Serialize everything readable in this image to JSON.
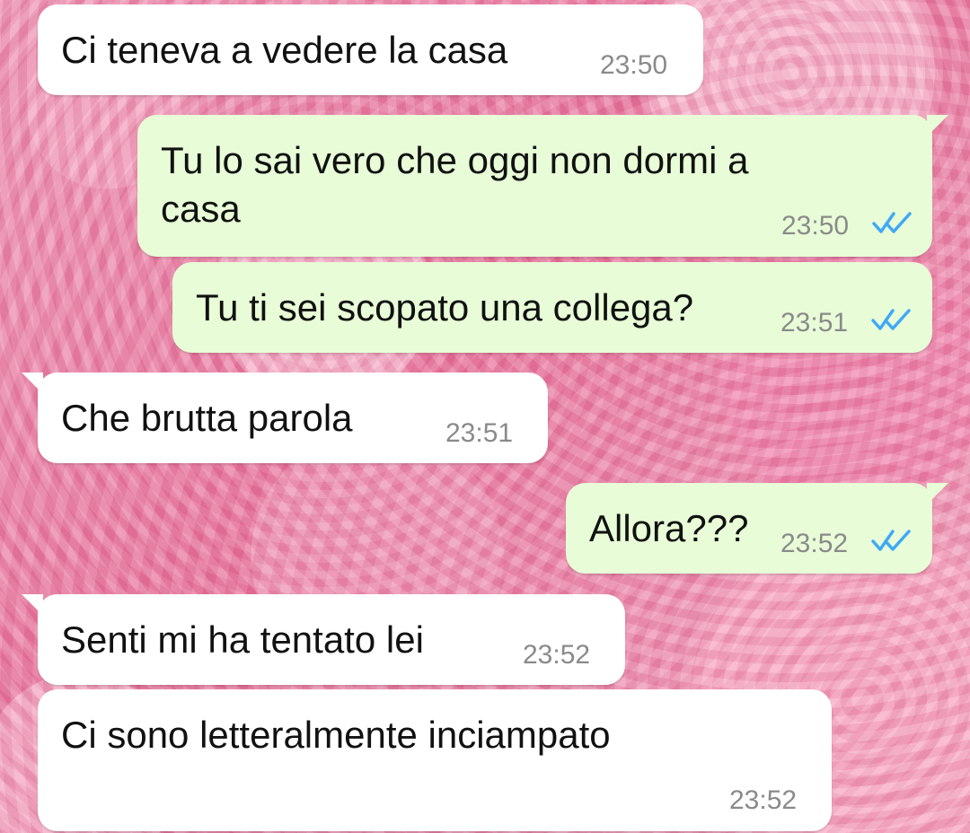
{
  "messages": [
    {
      "direction": "incoming",
      "text": "Ci teneva a vedere la casa",
      "time": "23:50"
    },
    {
      "direction": "outgoing",
      "text": "Tu lo sai vero che oggi non dormi a\ncasa",
      "time": "23:50",
      "status_icon": "double-check-icon"
    },
    {
      "direction": "outgoing",
      "text": "Tu ti sei scopato una collega?",
      "time": "23:51",
      "status_icon": "double-check-icon"
    },
    {
      "direction": "incoming",
      "text": "Che brutta parola",
      "time": "23:51"
    },
    {
      "direction": "outgoing",
      "text": "Allora???",
      "time": "23:52",
      "status_icon": "double-check-icon"
    },
    {
      "direction": "incoming",
      "text": "Senti mi ha tentato lei",
      "time": "23:52"
    },
    {
      "direction": "incoming",
      "text": "Ci sono letteralmente inciampato",
      "time": "23:52"
    }
  ],
  "colors": {
    "incoming_bubble": "#ffffff",
    "outgoing_bubble": "#e8fdd7",
    "time_text": "#8a8a8a",
    "read_tick": "#3fa9f5",
    "background_rose": "#ee8fb1"
  }
}
